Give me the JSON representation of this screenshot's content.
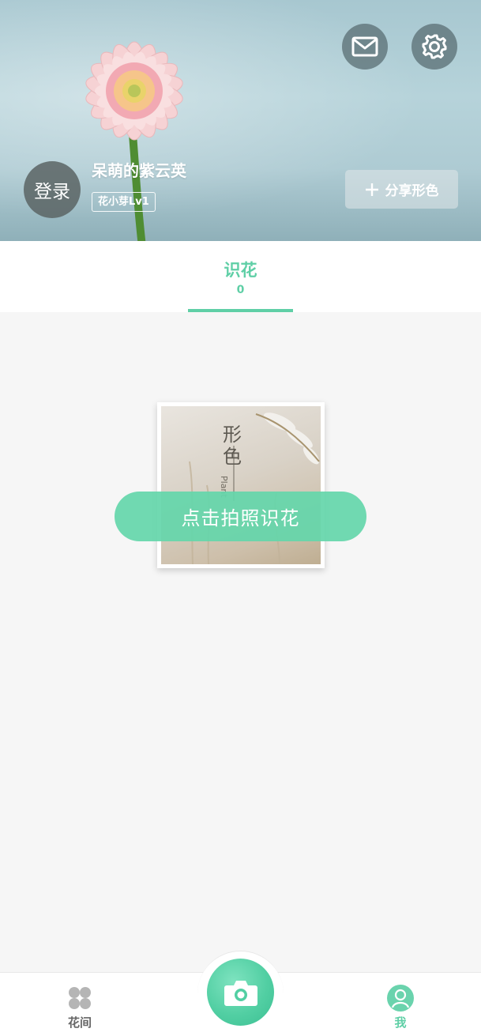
{
  "header": {
    "login_label": "登录",
    "username": "呆萌的紫云英",
    "level_badge": "花小芽Lv1",
    "share_label": "分享形色",
    "mail_icon": "mail-icon",
    "settings_icon": "gear-icon"
  },
  "tabs": [
    {
      "label": "识花",
      "count": "0",
      "active": true
    }
  ],
  "content": {
    "poster_title": "形色",
    "poster_subtitle": "Plant",
    "cta_label": "点击拍照识花"
  },
  "bottom_nav": {
    "home_label": "花间",
    "me_label": "我",
    "camera_icon": "camera-icon"
  },
  "colors": {
    "accent": "#5fcfa6",
    "header_bg": "#b6d3da"
  }
}
